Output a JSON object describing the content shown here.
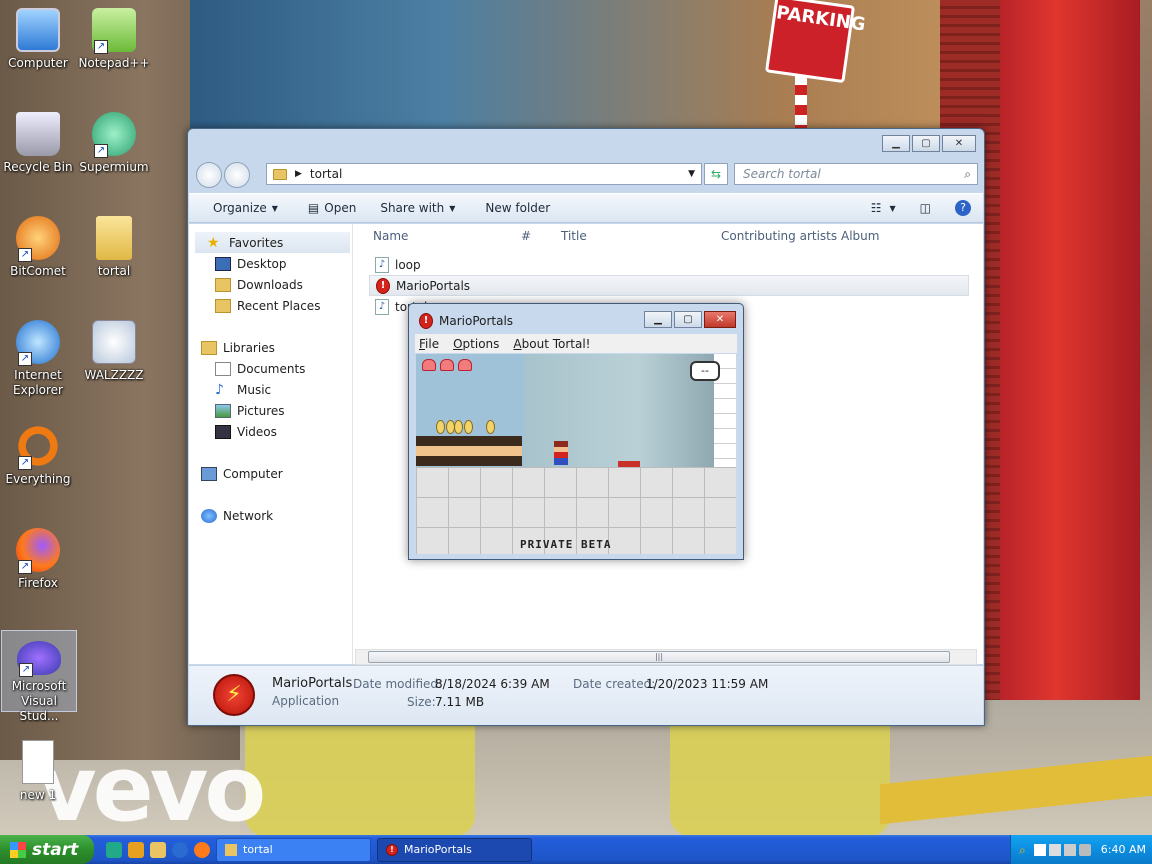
{
  "wallpaper": {
    "brand": "vevo",
    "sign": "PARKING"
  },
  "desktop": {
    "icons": [
      {
        "label": "Computer"
      },
      {
        "label": "Notepad++"
      },
      {
        "label": "Recycle Bin"
      },
      {
        "label": "Supermium"
      },
      {
        "label": "BitComet"
      },
      {
        "label": "tortal"
      },
      {
        "label": "Internet Explorer"
      },
      {
        "label": "WALZZZZ"
      },
      {
        "label": "Everything"
      },
      {
        "label": "Firefox"
      },
      {
        "label": "Microsoft Visual Stud..."
      },
      {
        "label": "new 1"
      }
    ]
  },
  "explorer": {
    "address": "tortal",
    "search_placeholder": "Search tortal",
    "toolbar": {
      "organize": "Organize",
      "open": "Open",
      "share": "Share with",
      "new_folder": "New folder"
    },
    "nav": {
      "favorites": "Favorites",
      "desktop": "Desktop",
      "downloads": "Downloads",
      "recent": "Recent Places",
      "libraries": "Libraries",
      "documents": "Documents",
      "music": "Music",
      "pictures": "Pictures",
      "videos": "Videos",
      "computer": "Computer",
      "network": "Network"
    },
    "columns": {
      "name": "Name",
      "num": "#",
      "title": "Title",
      "artists": "Contributing artists",
      "album": "Album"
    },
    "files": [
      {
        "name": "loop"
      },
      {
        "name": "MarioPortals"
      },
      {
        "name": "tortal"
      }
    ],
    "details": {
      "name": "MarioPortals",
      "type": "Application",
      "modified_label": "Date modified:",
      "modified": "8/18/2024 6:39 AM",
      "created_label": "Date created:",
      "created": "1/20/2023 11:59 AM",
      "size_label": "Size:",
      "size": "7.11 MB"
    }
  },
  "game": {
    "title": "MarioPortals",
    "menu": {
      "file": "File",
      "options": "Options",
      "about": "About Tortal!"
    },
    "hud": "--",
    "banner": "PRIVATE BETA"
  },
  "taskbar": {
    "start": "start",
    "tasks": [
      {
        "label": "tortal"
      },
      {
        "label": "MarioPortals"
      }
    ],
    "clock": "6:40 AM"
  }
}
